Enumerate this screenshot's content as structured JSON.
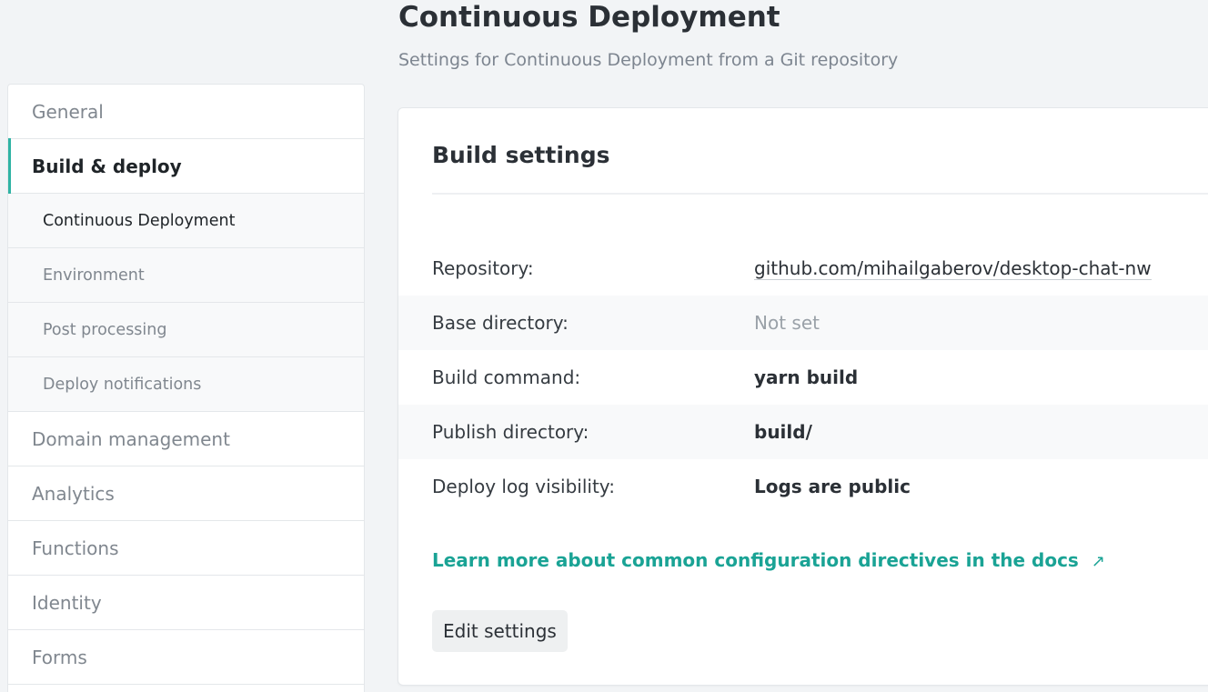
{
  "header": {
    "title": "Continuous Deployment",
    "subtitle": "Settings for Continuous Deployment from a Git repository"
  },
  "sidebar": {
    "items": [
      {
        "label": "General"
      },
      {
        "label": "Build & deploy",
        "active": true
      },
      {
        "label": "Continuous Deployment",
        "sub": true,
        "current": true
      },
      {
        "label": "Environment",
        "sub": true
      },
      {
        "label": "Post processing",
        "sub": true
      },
      {
        "label": "Deploy notifications",
        "sub": true
      },
      {
        "label": "Domain management"
      },
      {
        "label": "Analytics"
      },
      {
        "label": "Functions"
      },
      {
        "label": "Identity"
      },
      {
        "label": "Forms"
      }
    ]
  },
  "card": {
    "title": "Build settings",
    "rows": [
      {
        "label": "Repository:",
        "value": "github.com/mihailgaberov/desktop-chat-nw"
      },
      {
        "label": "Base directory:",
        "value": "Not set"
      },
      {
        "label": "Build command:",
        "value": "yarn build"
      },
      {
        "label": "Publish directory:",
        "value": "build/"
      },
      {
        "label": "Deploy log visibility:",
        "value": "Logs are public"
      }
    ],
    "docs_link": "Learn more about common configuration directives in the docs",
    "external_icon": "↗",
    "edit_button": "Edit settings"
  },
  "colors": {
    "accent": "#2fb3a4",
    "link": "#1aa395",
    "background": "#f2f4f6"
  }
}
